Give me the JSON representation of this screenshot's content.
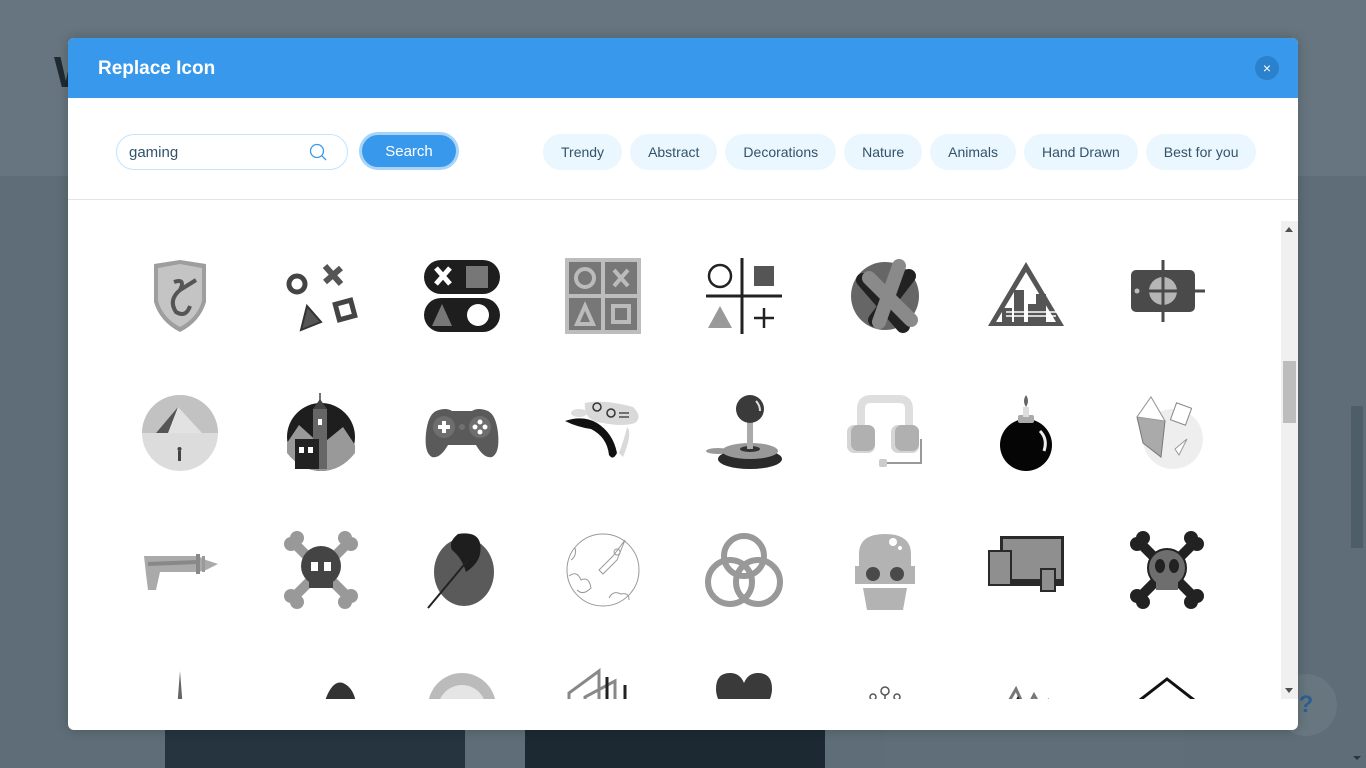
{
  "background": {
    "partial_heading_letter": "W",
    "help_label": "?"
  },
  "dialog": {
    "title": "Replace Icon",
    "close_label": "×",
    "search": {
      "value": "gaming",
      "placeholder": "",
      "button_label": "Search"
    },
    "categories": [
      {
        "label": "Trendy"
      },
      {
        "label": "Abstract"
      },
      {
        "label": "Decorations"
      },
      {
        "label": "Nature"
      },
      {
        "label": "Animals"
      },
      {
        "label": "Hand Drawn"
      },
      {
        "label": "Best for you"
      }
    ],
    "icons": [
      {
        "name": "dragon-shield-icon"
      },
      {
        "name": "game-symbols-scattered-icon"
      },
      {
        "name": "controller-buttons-icon"
      },
      {
        "name": "game-symbols-grid-icon"
      },
      {
        "name": "tic-tac-toe-symbols-icon"
      },
      {
        "name": "x-ball-icon"
      },
      {
        "name": "city-pyramid-icon"
      },
      {
        "name": "crosshair-device-icon"
      },
      {
        "name": "pyramid-explorer-icon"
      },
      {
        "name": "castle-tower-icon"
      },
      {
        "name": "gamepad-icon"
      },
      {
        "name": "mustache-controller-icon"
      },
      {
        "name": "joystick-icon"
      },
      {
        "name": "headset-icon"
      },
      {
        "name": "bomb-icon"
      },
      {
        "name": "crystal-shards-icon"
      },
      {
        "name": "ray-gun-icon"
      },
      {
        "name": "skull-crossbones-grey-icon"
      },
      {
        "name": "battle-axe-icon"
      },
      {
        "name": "rocket-planet-icon"
      },
      {
        "name": "triple-rings-icon"
      },
      {
        "name": "robot-head-icon"
      },
      {
        "name": "devices-icon"
      },
      {
        "name": "skull-crossbones-dark-icon"
      },
      {
        "name": "tower-icon"
      },
      {
        "name": "hat-icon"
      },
      {
        "name": "lion-icon"
      },
      {
        "name": "lines-building-icon"
      },
      {
        "name": "heart-icon"
      },
      {
        "name": "circuit-nodes-icon"
      },
      {
        "name": "mountains-icon"
      },
      {
        "name": "diamond-outline-icon"
      }
    ]
  },
  "colors": {
    "accent": "#3899ec",
    "chip_bg": "#eaf7ff",
    "text": "#32536a"
  }
}
